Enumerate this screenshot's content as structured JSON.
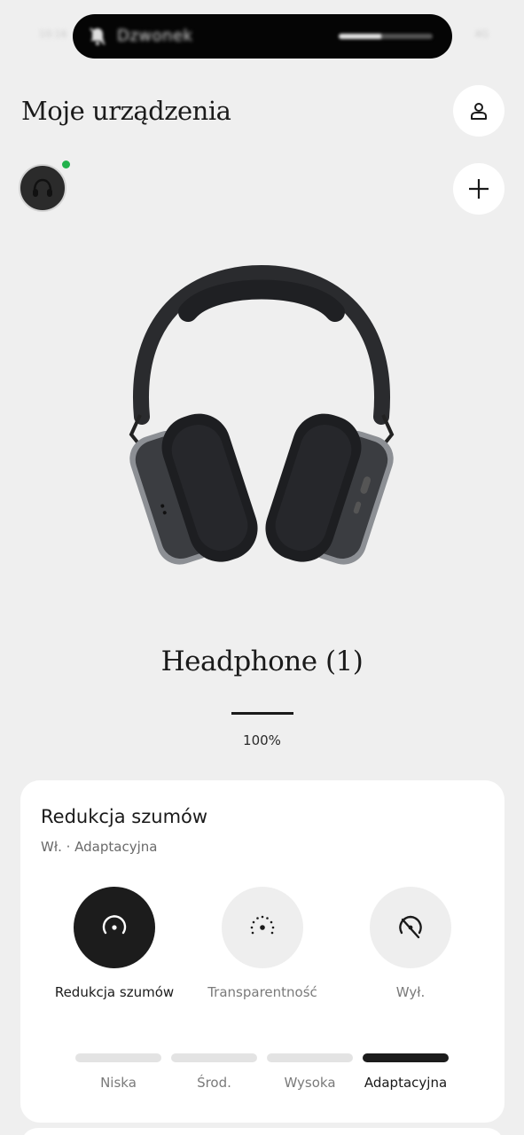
{
  "status_bar": {
    "time": "10:16",
    "island_label": "Dzwonek",
    "island_progress": 0.45,
    "right": "4G"
  },
  "header": {
    "title": "Moje urządzenia"
  },
  "device": {
    "name": "Headphone (1)",
    "battery_text": "100%",
    "battery_level": 1.0,
    "connected": true
  },
  "noise_card": {
    "title": "Redukcja szumów",
    "subtitle": "Wł. · Adaptacyjna",
    "modes": [
      {
        "label": "Redukcja szumów",
        "icon": "noise-cancelling-icon",
        "active": true
      },
      {
        "label": "Transparentność",
        "icon": "transparency-icon",
        "active": false
      },
      {
        "label": "Wył.",
        "icon": "off-icon",
        "active": false
      }
    ],
    "levels": [
      {
        "label": "Niska",
        "active": false
      },
      {
        "label": "Środ.",
        "active": false
      },
      {
        "label": "Wysoka",
        "active": false
      },
      {
        "label": "Adaptacyjna",
        "active": true
      }
    ]
  },
  "colors": {
    "background": "#efefef",
    "card": "#ffffff",
    "active": "#1c1c1c",
    "online_dot": "#22b14c"
  }
}
